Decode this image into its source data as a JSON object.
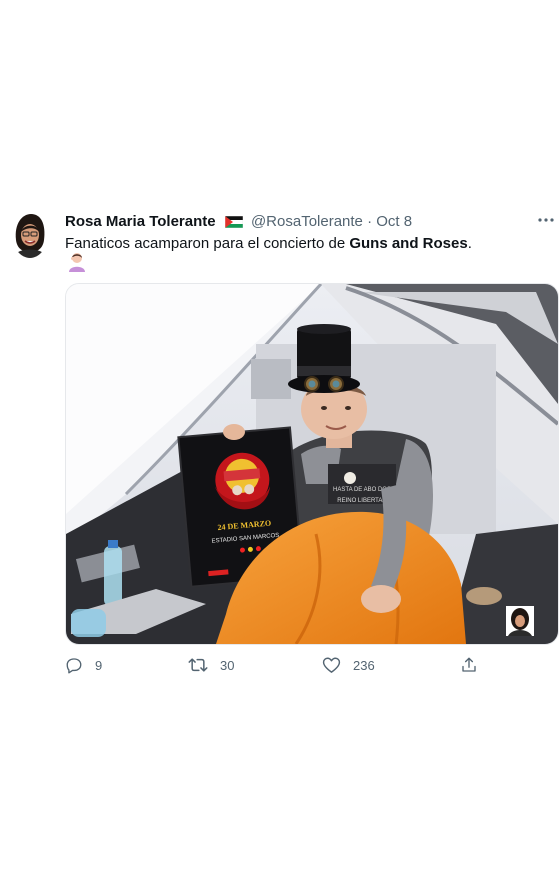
{
  "tweet": {
    "author_name": "Rosa Maria Tolerante",
    "handle": "@RosaTolerante",
    "separator": "·",
    "date": "Oct 8",
    "text_prefix": "Fanaticos acamparon para el concierto de ",
    "text_bold": "Guns and Roses",
    "text_suffix": ".",
    "media": {
      "poster_date": "24 DE MARZO",
      "poster_venue": "ESTADIO SAN MARCOS",
      "shirt_line1": "HASTA DE ABO DOS",
      "shirt_line2": "REINO LIBERTAD"
    },
    "actions": {
      "replies": "9",
      "retweets": "30",
      "likes": "236"
    }
  },
  "icons": {
    "more": "more-horizontal-icon",
    "reply": "reply-icon",
    "retweet": "retweet-icon",
    "like": "heart-icon",
    "share": "share-icon",
    "flag": "palestine-flag-icon",
    "emoji": "person-facepalming-emoji-icon"
  },
  "colors": {
    "text": "#0f1419",
    "secondary": "#536471"
  }
}
